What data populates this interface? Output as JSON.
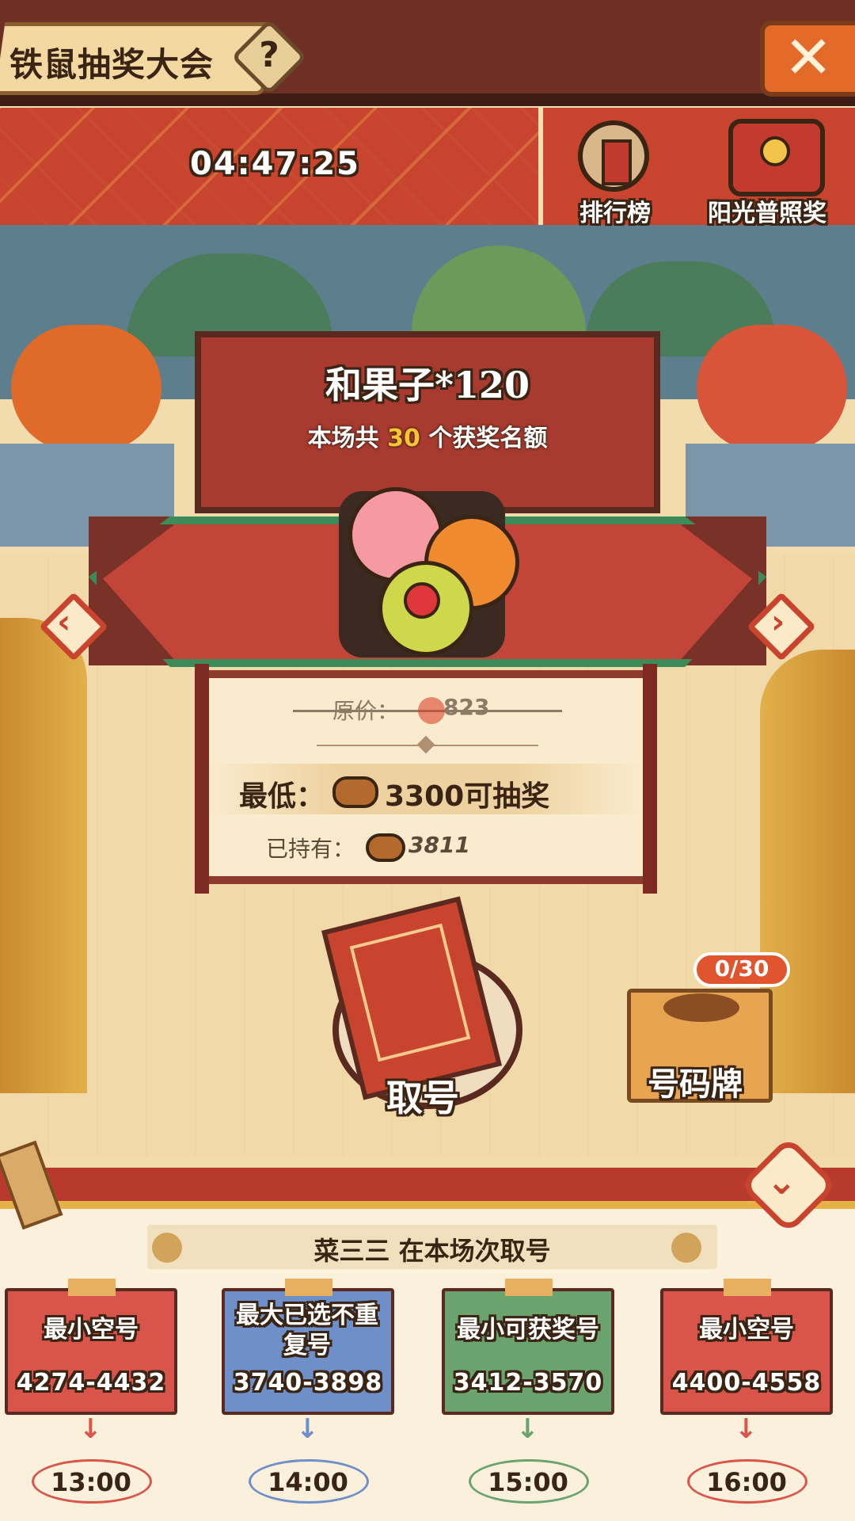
{
  "header": {
    "title": "铁鼠抽奖大会",
    "help_icon": "question-icon",
    "close_icon": "close-icon",
    "countdown": "04:47:25",
    "rank_label": "排行榜",
    "sunshine_label": "阳光普照奖"
  },
  "prize": {
    "name": "和果子*120",
    "quota_prefix": "本场共",
    "quota_number": "30",
    "quota_suffix": "个获奖名额",
    "original_label": "原价：",
    "original_value": "823",
    "min_label": "最低：",
    "min_value": "3300可抽奖",
    "owned_label": "已持有：",
    "owned_value": "3811"
  },
  "actions": {
    "draw_label": "取号",
    "box_label": "号码牌",
    "box_count": "0/30"
  },
  "info": {
    "banner": "菜三三 在本场次取号",
    "cards": [
      {
        "title": "最小空号",
        "range": "4274-4432",
        "time": "13:00",
        "color": "#d9544a"
      },
      {
        "title": "最大已选不重复号",
        "range": "3740-3898",
        "time": "14:00",
        "color": "#6f8fc9"
      },
      {
        "title": "最小可获奖号",
        "range": "3412-3570",
        "time": "15:00",
        "color": "#6aa36e"
      },
      {
        "title": "最小空号",
        "range": "4400-4558",
        "time": "16:00",
        "color": "#d9544a"
      }
    ]
  },
  "colors": {
    "accent_red": "#c8442e",
    "gold": "#f7c531",
    "dark": "#3a2414"
  }
}
